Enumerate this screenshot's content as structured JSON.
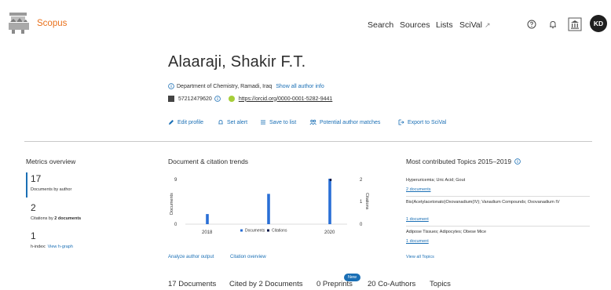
{
  "header": {
    "brand": "Scopus",
    "nav": {
      "search": "Search",
      "sources": "Sources",
      "lists": "Lists",
      "scival": "SciVal",
      "scival_ext": "↗"
    },
    "avatar_initials": "KD",
    "icons": [
      "help-icon",
      "bell-icon",
      "institution-icon"
    ]
  },
  "author": {
    "name": "Alaaraji, Shakir F.T.",
    "affiliation": "Department of Chemistry, Ramadi, Iraq",
    "show_all": "Show all author info",
    "author_id": "57212479620",
    "orcid": "https://orcid.org/0000-0001-5282-9441",
    "actions": {
      "edit": "Edit profile",
      "alert": "Set alert",
      "save": "Save to list",
      "matches": "Potential author matches",
      "export": "Export to SciVal"
    }
  },
  "metrics": {
    "title": "Metrics overview",
    "documents": {
      "value": "17",
      "label": "Documents by author"
    },
    "citations": {
      "value": "2",
      "label_prefix": "Citations by",
      "label_bold": "2 documents"
    },
    "hindex": {
      "value": "1",
      "label": "h-index:",
      "link": "View h-graph"
    }
  },
  "trends": {
    "title": "Document & citation trends",
    "analyze_link": "Analyze author output",
    "citation_link": "Citation overview"
  },
  "chart_data": {
    "type": "bar",
    "x_ticks": [
      "2018",
      "2020"
    ],
    "documents_axis": {
      "label": "Documents",
      "ticks": [
        "9",
        "0"
      ],
      "ylim": [
        0,
        9
      ]
    },
    "citations_axis": {
      "label": "Citations",
      "ticks": [
        "2",
        "1",
        "0"
      ],
      "ylim": [
        0,
        2
      ]
    },
    "legend": [
      "Documents",
      "Citations"
    ],
    "series": [
      {
        "name": "Documents",
        "color": "#2a6fd6",
        "points": [
          {
            "x": "2018",
            "value": 2
          },
          {
            "x": "2019",
            "value": 6
          },
          {
            "x": "2020",
            "value": 9
          }
        ]
      },
      {
        "name": "Citations",
        "color": "#0c1a4a",
        "points": [
          {
            "x": "2020",
            "value": 2
          }
        ]
      }
    ]
  },
  "topics": {
    "title": "Most contributed Topics 2015–2019",
    "items": [
      {
        "name": "Hyperuricemia; Uric Acid; Gout",
        "docs": "2 documents"
      },
      {
        "name": "Bis(Acetylacetonato)Oxovanadium(IV); Vanadium Compounds; Oxovanadium IV",
        "docs": "1 document"
      },
      {
        "name": "Adipose Tissues; Adipocytes; Obese Mice",
        "docs": "1 document"
      }
    ],
    "view_all": "View all Topics"
  },
  "tabs": {
    "documents": "17 Documents",
    "cited": "Cited by 2 Documents",
    "preprints": "0 Preprints",
    "new_badge": "New",
    "coauthors": "20 Co-Authors",
    "topics": "Topics"
  }
}
